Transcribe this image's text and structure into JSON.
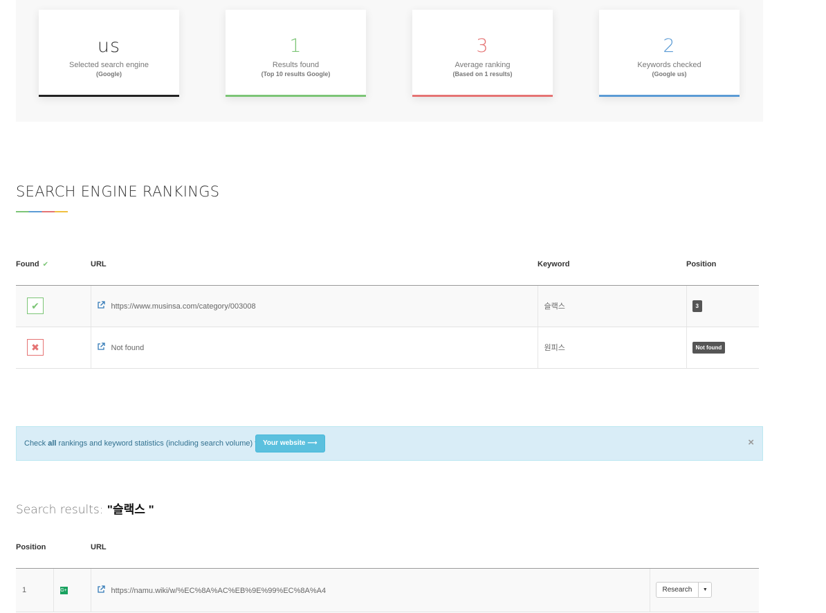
{
  "stats": [
    {
      "value": "us",
      "label": "Selected search engine",
      "sub": "(Google)",
      "color": "#333333",
      "bar": "#222222"
    },
    {
      "value": "1",
      "label": "Results found",
      "sub": "(Top 10 results Google)",
      "color": "#7cc576",
      "bar": "#7cc576"
    },
    {
      "value": "3",
      "label": "Average ranking",
      "sub": "(Based on 1 results)",
      "color": "#e57373",
      "bar": "#e57373"
    },
    {
      "value": "2",
      "label": "Keywords checked",
      "sub": "(Google us)",
      "color": "#5b9bd5",
      "bar": "#5b9bd5"
    }
  ],
  "rankings": {
    "title": "SEARCH ENGINE RANKINGS",
    "headers": {
      "found": "Found",
      "url": "URL",
      "keyword": "Keyword",
      "position": "Position"
    },
    "rows": [
      {
        "found": "yes",
        "url": "https://www.musinsa.com/category/003008",
        "keyword": "슬랙스",
        "position": "3"
      },
      {
        "found": "no",
        "url": "Not found",
        "keyword": "원피스",
        "position": "Not found"
      }
    ]
  },
  "alert": {
    "text_before": "Check ",
    "text_bold": "all",
    "text_after": " rankings and keyword statistics (including search volume) for",
    "button": "Your website ⟶",
    "close": "×"
  },
  "results": {
    "heading_prefix": "Search results: ",
    "query": "\"슬랙스 \"",
    "headers": {
      "position": "Position",
      "url": "URL"
    },
    "rows": [
      {
        "position": "1",
        "url": "https://namu.wiki/w/%EC%8A%AC%EB%9E%99%EC%8A%A4",
        "action": "Research"
      }
    ]
  }
}
